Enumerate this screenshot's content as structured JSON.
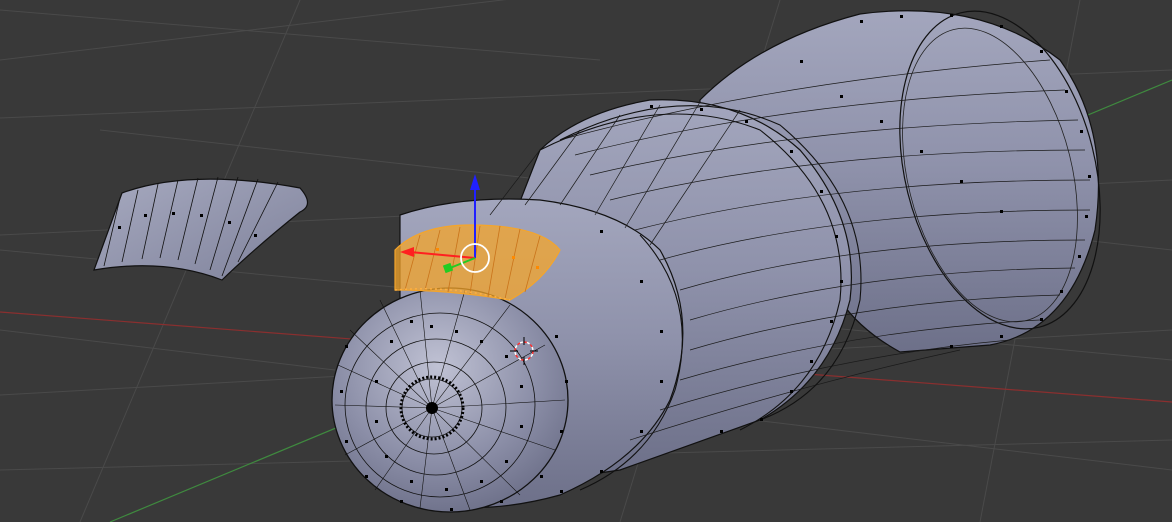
{
  "viewport": {
    "background_color": "#393939",
    "grid_color": "#4a4a4a",
    "x_axis_color": "#8a2f2f",
    "y_axis_color": "#3f8a3f",
    "mesh_fill_color": "#8c8fa8",
    "mesh_edge_color": "#000000",
    "selection_color": "#f5a52a"
  },
  "gizmo": {
    "x_handle_color": "#ff2020",
    "y_handle_color": "#22cc22",
    "z_handle_color": "#2020ff"
  },
  "cursor": {
    "icon": "3d-cursor-icon"
  }
}
